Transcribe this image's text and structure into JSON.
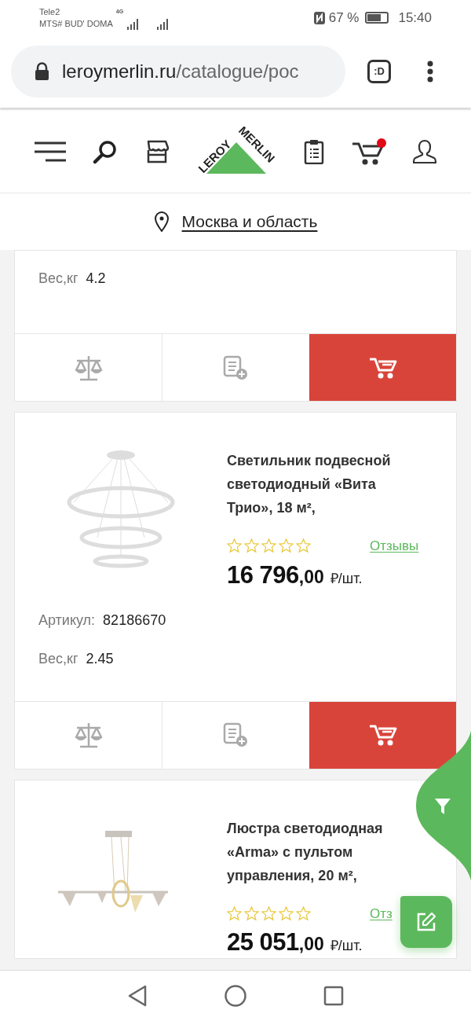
{
  "status_bar": {
    "carrier": "Tele2",
    "carrier_2": "MTS# BUD' DOMA",
    "network": "4G",
    "battery": "67 %",
    "time": "15:40"
  },
  "browser": {
    "url_host": "leroymerlin.ru",
    "url_path": "/catalogue/poc",
    "tab_button": ":D"
  },
  "site_header": {
    "logo": [
      "LEROY",
      "MERLIN"
    ],
    "cart_badge": true
  },
  "location": "Москва и область",
  "products": [
    {
      "partial": true,
      "specs": [
        {
          "label": "Вес,кг",
          "value": "4.2"
        }
      ]
    },
    {
      "title": "Светильник подвесной светодиодный «Вита Трио», 18 м²,",
      "stars": 0,
      "reviews": "Отзывы",
      "price_int": "16 796",
      "price_dec": ",00",
      "unit": "₽/шт.",
      "specs": [
        {
          "label": "Артикул:",
          "value": "82186670"
        },
        {
          "label": "Вес,кг",
          "value": "2.45"
        }
      ]
    },
    {
      "title": "Люстра светодиодная «Arma» с пультом управления, 20 м²,",
      "stars": 0,
      "reviews": "Отз",
      "price_int": "25 051",
      "price_dec": ",00",
      "unit": "₽/шт."
    }
  ]
}
